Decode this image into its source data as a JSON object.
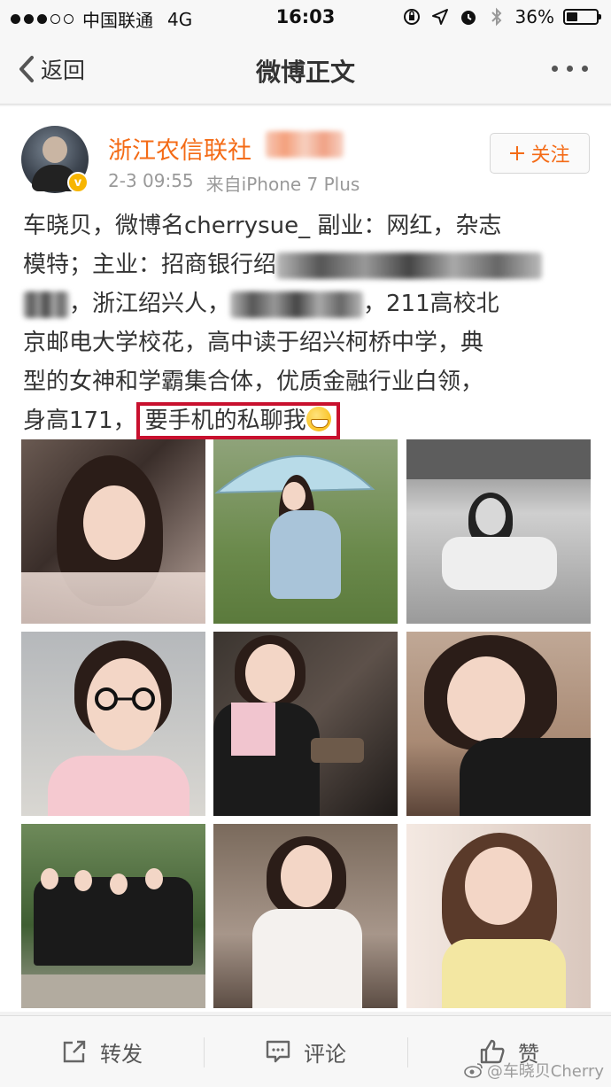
{
  "status_bar": {
    "carrier": "中国联通",
    "network": "4G",
    "time": "16:03",
    "battery": "36%",
    "battery_level": 0.36,
    "signal_bars_filled": 3,
    "signal_bars_total": 5
  },
  "nav": {
    "back_label": "返回",
    "title": "微博正文"
  },
  "post": {
    "author": "浙江农信联社",
    "verified_badge": "v",
    "date": "2-3 09:55",
    "source": "来自iPhone 7 Plus",
    "follow_label": "关注",
    "text": {
      "line1": "车晓贝，微博名cherrysue_ 副业：网红，杂志",
      "line2_start": "模特；主业：招商银行绍",
      "line3_mid": "，浙江绍兴人，",
      "line3_end": "，211高校北",
      "line4": "京邮电大学校花，高中读于绍兴柯桥中学，典",
      "line5": "型的女神和学霸集合体，优质金融行业白领，",
      "line6_start": "身高171，",
      "highlight": "要手机的私聊我"
    },
    "photo_count": 9
  },
  "toolbar": {
    "repost_label": "转发",
    "comment_label": "评论",
    "like_label": "赞"
  },
  "watermark": "@车晓贝Cherry",
  "colors": {
    "accent_orange": "#f46b16",
    "highlight_red": "#c8102e",
    "verified_yellow": "#f7b500"
  }
}
